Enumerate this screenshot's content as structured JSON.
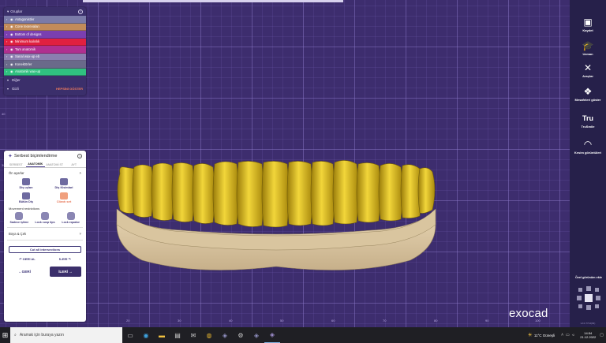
{
  "groups": {
    "title": "Gruplar",
    "items": [
      {
        "label": "Antagonistler",
        "color": "#7a7aa8"
      },
      {
        "label": "Cone teorevaları",
        "color": "#c28b5a"
      },
      {
        "label": "Bottom of designs",
        "color": "#7a3fb0"
      },
      {
        "label": "Minimum kalınlık",
        "color": "#e02040"
      },
      {
        "label": "Tam anatomik",
        "color": "#b03090"
      },
      {
        "label": "Sanal wax-up eb",
        "color": "#8a7fb0"
      },
      {
        "label": "Konektörler",
        "color": "#6a6a8a"
      },
      {
        "label": "Anatomik wax-up",
        "color": "#30c080"
      }
    ],
    "others_label": "Diğer",
    "hide_label": "Gizli",
    "show_all_label": "HEPSİNİ GÖSTER"
  },
  "freeform": {
    "title": "Serbest biçimlendirme",
    "tabs": [
      "SERBEST",
      "ANATOMİK",
      "ANATOMİ ST",
      "AYT"
    ],
    "active_tab": 1,
    "preset_heading": "Ön ayarlar",
    "tools": [
      {
        "label": "Diş uçları"
      },
      {
        "label": "Diş Kisimlari"
      },
      {
        "label": "Bütün Diş"
      },
      {
        "label": "Cilantı sırt",
        "accent": true
      }
    ],
    "movement_heading": "Movement restrictions",
    "movements": [
      "Sadece işlime",
      "Lock cusp tips",
      "Lock equator"
    ],
    "paint_section": "Boya & Çek",
    "cut_button": "Cut all intersections",
    "undo_label": "GERİ AL",
    "redo_label": "İLERİ",
    "back_label": "GERİ",
    "next_label": "İLERİ"
  },
  "toolbar": {
    "items": [
      {
        "label": "Kaydet",
        "icon": "save-icon"
      },
      {
        "label": "Uzman",
        "icon": "expert-icon"
      },
      {
        "label": "Araçlar",
        "icon": "tools-icon"
      },
      {
        "label": "Mesafeleri göster",
        "icon": "distances-icon"
      },
      {
        "label": "TruSmile",
        "icon": "trusmile-icon"
      },
      {
        "label": "Kesim görüntüleri",
        "icon": "cut-view-icon"
      }
    ],
    "view_label": "Özel görünüm ekle",
    "version": "v3.0-7714(64)"
  },
  "brand": "exocad",
  "ruler": {
    "x_ticks": [
      "20",
      "30",
      "40",
      "50",
      "60",
      "70",
      "80",
      "90",
      "100"
    ],
    "y_ticks": [
      "40",
      "30"
    ]
  },
  "taskbar": {
    "search_placeholder": "Aramak için buraya yazın",
    "weather": "11°C Güneşli",
    "time": "14:54",
    "date": "21.12.2022"
  }
}
